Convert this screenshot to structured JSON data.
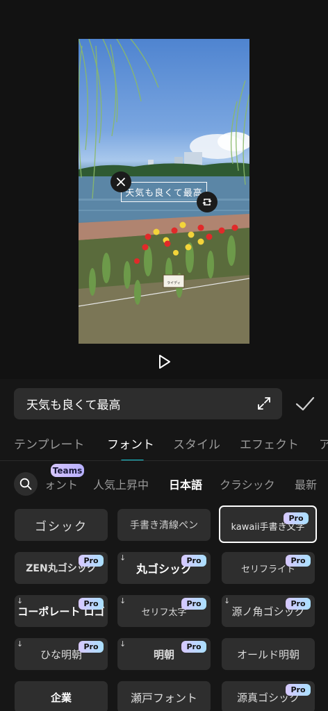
{
  "overlay": {
    "text": "天気も良くて最高"
  },
  "editor": {
    "text_value": "天気も良くて最高"
  },
  "tabs": [
    {
      "label": "テンプレート"
    },
    {
      "label": "フォント"
    },
    {
      "label": "スタイル"
    },
    {
      "label": "エフェクト"
    },
    {
      "label": "ア"
    }
  ],
  "categories": [
    {
      "label": "ォント"
    },
    {
      "label": "人気上昇中"
    },
    {
      "label": "日本語"
    },
    {
      "label": "クラシック"
    },
    {
      "label": "最新"
    }
  ],
  "teams_badge": "Teams",
  "pro_label": "Pro",
  "fonts": [
    {
      "label": "ゴシック"
    },
    {
      "label": "手書き清線ペン"
    },
    {
      "label": "kawaii手書き文字"
    },
    {
      "label": "ZEN丸ゴシック"
    },
    {
      "label": "丸ゴシック"
    },
    {
      "label": "セリフライト"
    },
    {
      "label": "コーポレート ロゴ"
    },
    {
      "label": "セリフ太字"
    },
    {
      "label": "源ノ角ゴシック"
    },
    {
      "label": "ひな明朝"
    },
    {
      "label": "明朝"
    },
    {
      "label": "オールド明朝"
    },
    {
      "label": "企業"
    },
    {
      "label": "瀬戸フォント"
    },
    {
      "label": "源真ゴシック"
    }
  ],
  "photo_sign": "ライディ",
  "colors": {
    "accent": "#19d3e0",
    "panel": "#161616",
    "tile": "#2e2e2e"
  }
}
